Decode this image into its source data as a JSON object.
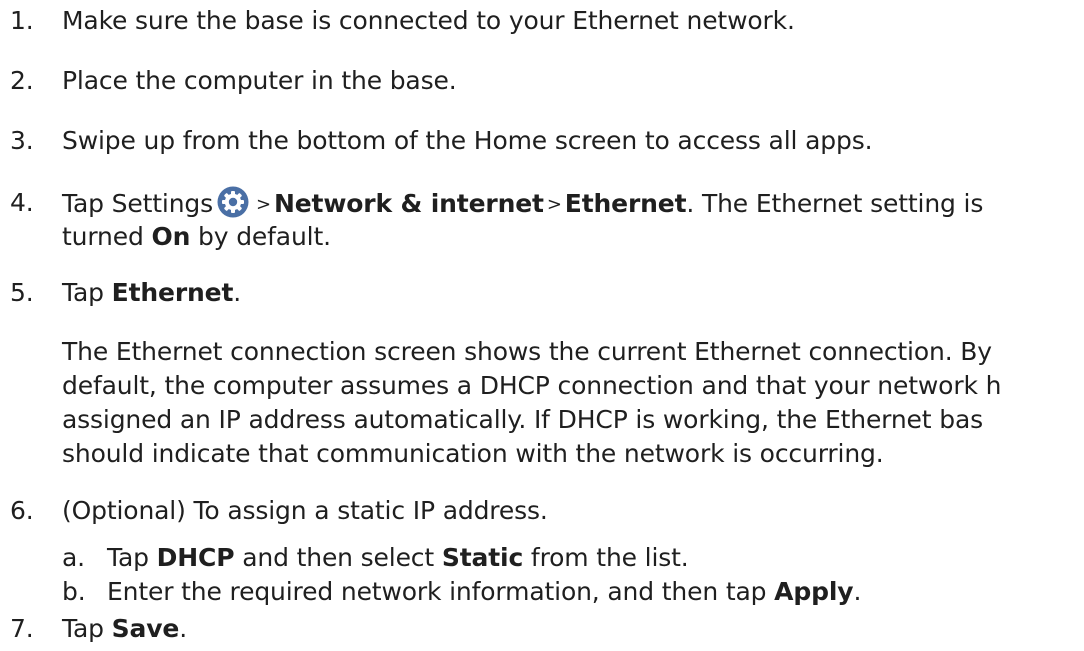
{
  "steps": [
    {
      "num": "1.",
      "text": "Make sure the base is connected to your Ethernet network."
    },
    {
      "num": "2.",
      "text": "Place the computer in the base."
    },
    {
      "num": "3.",
      "text": "Swipe up from the bottom of the Home screen to access all apps."
    },
    {
      "num": "4.",
      "pre": "Tap Settings",
      "icon": "settings-gear-icon",
      "sep1": ">",
      "bold1": "Network & internet",
      "sep2": ">",
      "bold2": "Ethernet",
      "post": ". The Ethernet setting is",
      "line2_pre": "turned ",
      "line2_bold": "On",
      "line2_post": " by default."
    },
    {
      "num": "5.",
      "pre": "Tap ",
      "bold": "Ethernet",
      "post": ".",
      "paragraph": [
        "The Ethernet connection screen shows the current Ethernet connection. By",
        "default, the computer assumes a DHCP connection and that your network h",
        "assigned an IP address automatically. If DHCP is working, the Ethernet bas",
        "should indicate that communication with the network is occurring."
      ]
    },
    {
      "num": "6.",
      "text": "(Optional) To assign a static IP address.",
      "substeps": [
        {
          "num": "a.",
          "pre": "Tap ",
          "bold1": "DHCP",
          "mid": " and then select ",
          "bold2": "Static",
          "post": " from the list."
        },
        {
          "num": "b.",
          "pre": "Enter the required network information, and then tap ",
          "bold": "Apply",
          "post": "."
        }
      ]
    },
    {
      "num": "7.",
      "pre": "Tap ",
      "bold": "Save",
      "post": "."
    }
  ],
  "colors": {
    "text": "#1f1f1f",
    "icon_bg": "#4a6fa5",
    "icon_fg": "#ffffff"
  }
}
